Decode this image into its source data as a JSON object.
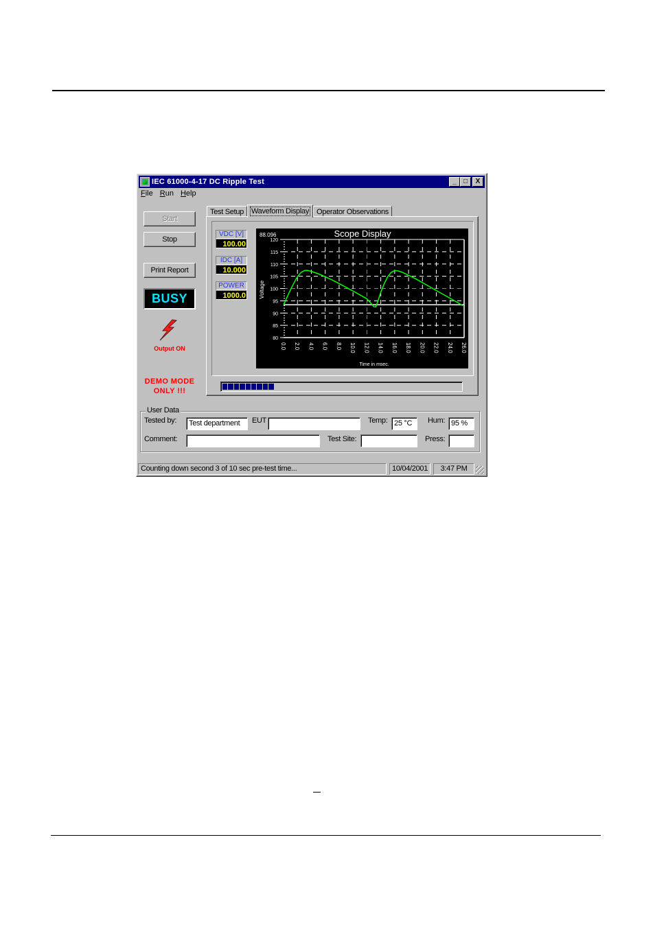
{
  "window": {
    "title": "IEC 61000-4-17 DC Ripple Test",
    "controls": [
      "_",
      "□",
      "X"
    ]
  },
  "menu": [
    {
      "label": "File",
      "accel": "F",
      "rest": "ile"
    },
    {
      "label": "Run",
      "accel": "R",
      "rest": "un"
    },
    {
      "label": "Help",
      "accel": "H",
      "rest": "elp"
    }
  ],
  "left_panel": {
    "start_label": "Start",
    "stop_label": "Stop",
    "print_label": "Print Report",
    "busy_label": "BUSY",
    "output_status": "Output ON",
    "demo_line1": "DEMO MODE",
    "demo_line2": "ONLY !!!"
  },
  "tabs": [
    {
      "label": "Test Setup",
      "active": false
    },
    {
      "label": "Waveform Display",
      "active": true
    },
    {
      "label": "Operator Observations",
      "active": false
    }
  ],
  "meters": [
    {
      "label": "VDC [V]",
      "value": "100.00"
    },
    {
      "label": "IDC [A]",
      "value": "10.000"
    },
    {
      "label": "POWER",
      "value": "1000.0"
    }
  ],
  "progress": {
    "percent": 21,
    "blocks": 9
  },
  "user_data": {
    "group_title": "User Data",
    "tested_by_label": "Tested by:",
    "tested_by_value": "Test department",
    "eut_label": "EUT",
    "eut_value": "",
    "temp_label": "Temp:",
    "temp_value": "25 °C",
    "hum_label": "Hum:",
    "hum_value": "95 %",
    "comment_label": "Comment:",
    "comment_value": "",
    "test_site_label": "Test Site:",
    "test_site_value": "",
    "press_label": "Press:",
    "press_value": ""
  },
  "status_bar": {
    "message": "Counting down second 3 of 10 sec pre-test time...",
    "date": "10/04/2001",
    "time": "3:47 PM"
  },
  "colors": {
    "trace": "#00ff00",
    "busy_text": "#00e5ff",
    "meter_value": "#ffff00",
    "meter_label": "#2233ee",
    "alert_red": "#ff0000",
    "titlebar": "#000080"
  },
  "chart_data": {
    "type": "line",
    "title": "Scope Display",
    "readout": "88.096",
    "xlabel": "Time in msec.",
    "ylabel": "Voltage",
    "xlim": [
      0,
      26
    ],
    "ylim": [
      80,
      120
    ],
    "xticks": [
      "0.0",
      "2.0",
      "4.0",
      "6.0",
      "8.0",
      "10.0",
      "12.0",
      "14.0",
      "16.0",
      "18.0",
      "20.0",
      "22.0",
      "24.0",
      "26.0"
    ],
    "yticks": [
      "80",
      "85",
      "90",
      "95",
      "100",
      "105",
      "110",
      "115",
      "120"
    ],
    "grid": true,
    "reference_level": 93.4,
    "series": [
      {
        "name": "Voltage",
        "x": [
          0.0,
          0.5,
          1.0,
          1.5,
          2.0,
          2.5,
          3.0,
          3.4,
          4.0,
          5.0,
          6.0,
          7.0,
          8.0,
          9.0,
          10.0,
          11.0,
          12.0,
          12.7,
          13.0,
          13.3,
          13.6,
          14.0,
          14.5,
          15.0,
          15.5,
          16.0,
          16.5,
          17.0,
          18.0,
          19.0,
          20.0,
          21.0,
          22.0,
          23.0,
          24.0,
          25.0,
          25.8
        ],
        "values": [
          93.2,
          96.5,
          99.5,
          102.3,
          104.8,
          106.5,
          107.3,
          107.4,
          107.0,
          106.0,
          104.8,
          103.5,
          102.0,
          100.5,
          99.0,
          97.4,
          95.8,
          93.6,
          92.6,
          92.5,
          95.0,
          98.5,
          102.0,
          104.8,
          106.6,
          107.3,
          107.2,
          106.7,
          105.4,
          104.0,
          102.4,
          100.8,
          99.2,
          97.6,
          96.0,
          94.4,
          93.0
        ]
      }
    ]
  }
}
